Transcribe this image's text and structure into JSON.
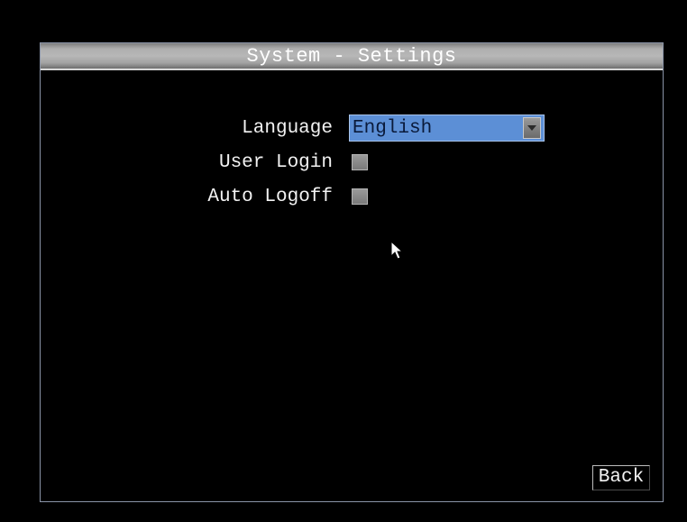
{
  "window": {
    "title": "System - Settings"
  },
  "settings": {
    "language": {
      "label": "Language",
      "value": "English"
    },
    "user_login": {
      "label": "User Login",
      "checked": false
    },
    "auto_logoff": {
      "label": "Auto Logoff",
      "checked": false
    }
  },
  "footer": {
    "back_label": "Back"
  },
  "colors": {
    "select_bg": "#5c8fd6",
    "checkbox_bg": "#8a8a8a",
    "titlebar": "#b7b7b7"
  },
  "icons": {
    "dropdown": "chevron-down-icon",
    "pointer": "mouse-pointer-icon"
  }
}
